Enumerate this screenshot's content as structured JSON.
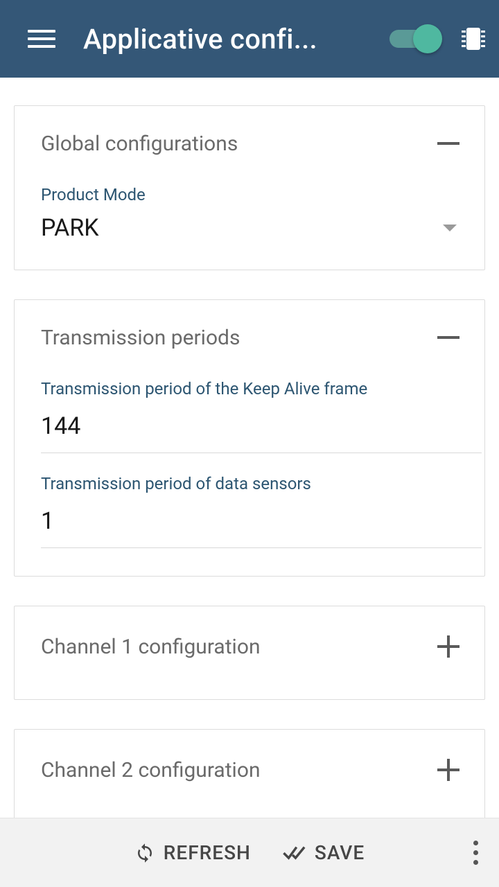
{
  "header": {
    "title": "Applicative confi..."
  },
  "sections": {
    "global": {
      "title": "Global configurations",
      "productModeLabel": "Product Mode",
      "productModeValue": "PARK"
    },
    "transmission": {
      "title": "Transmission periods",
      "keepAliveLabel": "Transmission period of the Keep Alive frame",
      "keepAliveValue": "144",
      "dataSensorsLabel": "Transmission period of data sensors",
      "dataSensorsValue": "1"
    },
    "channel1": {
      "title": "Channel 1 configuration"
    },
    "channel2": {
      "title": "Channel 2 configuration"
    }
  },
  "footer": {
    "refresh": "REFRESH",
    "save": "SAVE"
  }
}
